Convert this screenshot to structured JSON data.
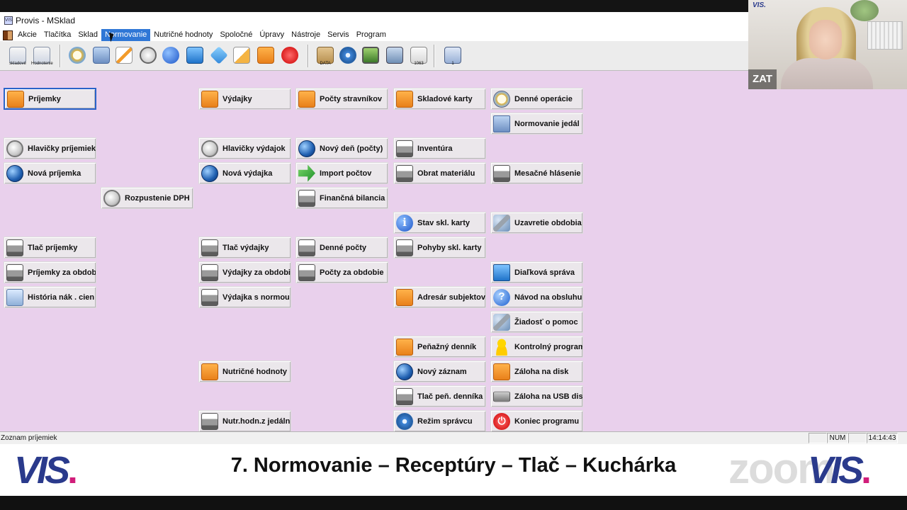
{
  "window": {
    "title": "Provis - MSklad",
    "app_icon": "VIS"
  },
  "menu": {
    "items": [
      "Akcie",
      "Tlačítka",
      "Sklad",
      "Normovanie",
      "Nutričné hodnoty",
      "Spoločné",
      "Úpravy",
      "Nástroje",
      "Servis",
      "Program"
    ],
    "active_index": 3
  },
  "toolbar": {
    "icons": [
      {
        "name": "shield-icon",
        "label": "skladové"
      },
      {
        "name": "shield-edit-icon",
        "label": "Hodnotenie"
      },
      {
        "name": "clock-icon",
        "label": ""
      },
      {
        "name": "calculator-icon",
        "label": ""
      },
      {
        "name": "edit-icon",
        "label": ""
      },
      {
        "name": "magnifier-icon",
        "label": ""
      },
      {
        "name": "info-icon",
        "label": ""
      },
      {
        "name": "monitor-icon",
        "label": ""
      },
      {
        "name": "diamond-icon",
        "label": ""
      },
      {
        "name": "note-icon",
        "label": ""
      },
      {
        "name": "folder-icon",
        "label": ""
      },
      {
        "name": "power-icon",
        "label": ""
      },
      {
        "name": "data-box-icon",
        "label": "DATA"
      },
      {
        "name": "gear-icon",
        "label": ""
      },
      {
        "name": "screen-icon",
        "label": ""
      },
      {
        "name": "network-icon",
        "label": ""
      },
      {
        "name": "mail-icon",
        "label": "1063"
      },
      {
        "name": "page-one-icon",
        "label": "1"
      }
    ]
  },
  "buttons": [
    {
      "label": "Príjemky",
      "icon": "folder",
      "col": 0,
      "row": 0,
      "focus": true
    },
    {
      "label": "Hlavičky príjemiek",
      "icon": "magnify",
      "col": 0,
      "row": 2
    },
    {
      "label": "Nová príjemka",
      "icon": "globe",
      "col": 0,
      "row": 3
    },
    {
      "label": "Rozpustenie DPH",
      "icon": "magnify",
      "col": 1,
      "row": 4
    },
    {
      "label": "Tlač príjemky",
      "icon": "printer",
      "col": 0,
      "row": 6
    },
    {
      "label": "Príjemky za obdobie",
      "icon": "printer",
      "col": 0,
      "row": 7
    },
    {
      "label": "História nák . cien",
      "icon": "history",
      "col": 0,
      "row": 8
    },
    {
      "label": "Výdajky",
      "icon": "folder",
      "col": 2,
      "row": 0
    },
    {
      "label": "Hlavičky výdajok",
      "icon": "magnify",
      "col": 2,
      "row": 2
    },
    {
      "label": "Nová výdajka",
      "icon": "globe",
      "col": 2,
      "row": 3
    },
    {
      "label": "Tlač výdajky",
      "icon": "printer",
      "col": 2,
      "row": 6
    },
    {
      "label": "Výdajky za obdobie",
      "icon": "printer",
      "col": 2,
      "row": 7
    },
    {
      "label": "Výdajka s normou",
      "icon": "printer",
      "col": 2,
      "row": 8
    },
    {
      "label": "Nutričné hodnoty",
      "icon": "folder",
      "col": 2,
      "row": 11
    },
    {
      "label": "Nutr.hodn.z jedáln.",
      "icon": "printer",
      "col": 2,
      "row": 13
    },
    {
      "label": "Počty stravníkov",
      "icon": "folder",
      "col": 3,
      "row": 0
    },
    {
      "label": "Nový deň (počty)",
      "icon": "globe",
      "col": 3,
      "row": 2
    },
    {
      "label": "Import počtov",
      "icon": "arrow-green",
      "col": 3,
      "row": 3
    },
    {
      "label": "Finančná bilancia",
      "icon": "printer",
      "col": 3,
      "row": 4
    },
    {
      "label": "Denné počty",
      "icon": "printer",
      "col": 3,
      "row": 6
    },
    {
      "label": "Počty za obdobie",
      "icon": "printer",
      "col": 3,
      "row": 7
    },
    {
      "label": "Skladové karty",
      "icon": "folder",
      "col": 4,
      "row": 0
    },
    {
      "label": "Inventúra",
      "icon": "printer",
      "col": 4,
      "row": 2
    },
    {
      "label": "Obrat materiálu",
      "icon": "printer",
      "col": 4,
      "row": 3
    },
    {
      "label": "Stav skl. karty",
      "icon": "info",
      "col": 4,
      "row": 5
    },
    {
      "label": "Pohyby skl. karty",
      "icon": "printer",
      "col": 4,
      "row": 6
    },
    {
      "label": "Adresár subjektov",
      "icon": "folder",
      "col": 4,
      "row": 8
    },
    {
      "label": "Peňažný denník",
      "icon": "folder",
      "col": 4,
      "row": 10
    },
    {
      "label": "Nový záznam",
      "icon": "globe",
      "col": 4,
      "row": 11
    },
    {
      "label": "Tlač peň. denníka",
      "icon": "printer",
      "col": 4,
      "row": 12
    },
    {
      "label": "Režim správcu",
      "icon": "gear",
      "col": 4,
      "row": 13
    },
    {
      "label": "Denné operácie",
      "icon": "clock",
      "col": 5,
      "row": 0
    },
    {
      "label": "Normovanie jedál",
      "icon": "calc",
      "col": 5,
      "row": 1
    },
    {
      "label": "Mesačné hlásenie",
      "icon": "printer",
      "col": 5,
      "row": 3
    },
    {
      "label": "Uzavretie obdobia",
      "icon": "wrench",
      "col": 5,
      "row": 5
    },
    {
      "label": "Diaľková správa",
      "icon": "monitor",
      "col": 5,
      "row": 7
    },
    {
      "label": "Návod na obsluhu",
      "icon": "question",
      "col": 5,
      "row": 8
    },
    {
      "label": "Žiadosť o pomoc",
      "icon": "wrench",
      "col": 5,
      "row": 9
    },
    {
      "label": "Kontrolný program",
      "icon": "person",
      "col": 5,
      "row": 10
    },
    {
      "label": "Záloha na disk",
      "icon": "folder",
      "col": 5,
      "row": 11
    },
    {
      "label": "Záloha na USB disk",
      "icon": "usb",
      "col": 5,
      "row": 12
    },
    {
      "label": "Koniec programu",
      "icon": "power",
      "col": 5,
      "row": 13
    }
  ],
  "status": {
    "text": "Zoznam príjemiek",
    "num": "NUM",
    "time": "14:14:43"
  },
  "presentation": {
    "caption": "7. Normovanie – Receptúry – Tlač – Kuchárka",
    "logo_text": "VIS",
    "watermark": "zoom"
  },
  "webcam": {
    "participant": "ZAT",
    "logo": "VIS."
  },
  "colors": {
    "panel_bg": "#e9d0ec",
    "menu_active": "#2f77d6",
    "logo_blue": "#2a3a8c",
    "logo_dot": "#d11d7a"
  }
}
